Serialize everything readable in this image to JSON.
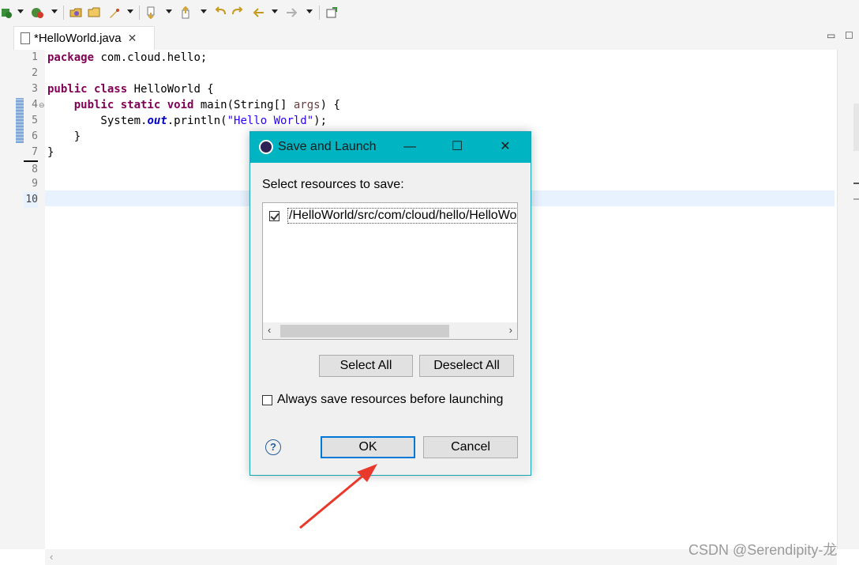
{
  "editor_tab": {
    "label": "*HelloWorld.java",
    "close": "✕"
  },
  "gutter": {
    "line_numbers": [
      "1",
      "2",
      "3",
      "4",
      "5",
      "6",
      "7",
      "8",
      "9",
      "10"
    ]
  },
  "code": {
    "l1_kw": "package",
    "l1_rest": " com.cloud.hello;",
    "l3_kw": "public class",
    "l3_rest": " HelloWorld {",
    "l4_indent": "    ",
    "l4_kw": "public static void",
    "l4_mid": " main(String[] ",
    "l4_param": "args",
    "l4_end": ") {",
    "l5_a": "        System.",
    "l5_field": "out",
    "l5_b": ".println(",
    "l5_str": "\"Hello World\"",
    "l5_c": ");",
    "l6": "    }",
    "l7": "}"
  },
  "dialog": {
    "title": "Save and Launch",
    "prompt": "Select resources to save:",
    "resource_path": "/HelloWorld/src/com/cloud/hello/HelloWorld.java",
    "resource_checked": true,
    "select_all": "Select All",
    "deselect_all": "Deselect All",
    "always_save_label": "Always save resources before launching",
    "always_save_checked": false,
    "ok": "OK",
    "cancel": "Cancel",
    "help_glyph": "?"
  },
  "icons": [
    "run-icon",
    "debug-icon",
    "open-icon",
    "folder-icon",
    "external-tools-icon",
    "next-annotation-icon",
    "prev-annotation-icon",
    "back-icon",
    "forward-icon",
    "pin-icon",
    "help-icon",
    "gear-icon"
  ],
  "colors": {
    "dialog_title_bar": "#00b4c2",
    "keyword": "#7f0055",
    "string": "#2a00ff",
    "current_line": "#e8f2fe",
    "arrow": "#e8392c"
  },
  "watermark": "CSDN @Serendipity-龙"
}
